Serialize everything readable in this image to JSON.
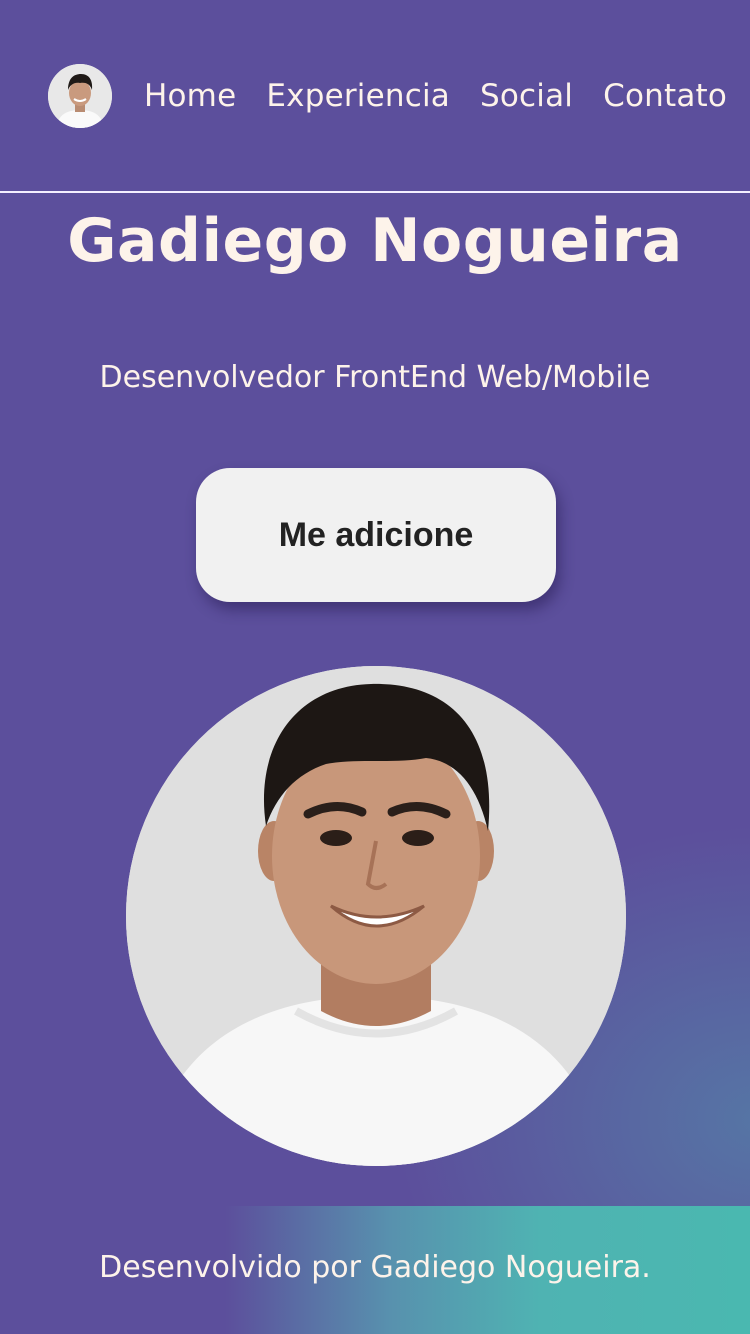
{
  "header": {
    "avatar_icon": "profile-avatar",
    "nav": [
      {
        "label": "Home"
      },
      {
        "label": "Experiencia"
      },
      {
        "label": "Social"
      },
      {
        "label": "Contato"
      }
    ]
  },
  "hero": {
    "title": "Gadiego Nogueira",
    "subtitle": "Desenvolvedor FrontEnd Web/Mobile",
    "cta_label": "Me adicione"
  },
  "footer": {
    "text": "Desenvolvido por Gadiego Nogueira."
  },
  "colors": {
    "background": "#5c4f9c",
    "text": "#fdf3ea",
    "button_bg": "#f1f1f1",
    "button_text": "#222222",
    "footer_accent": "#4ab8b0"
  }
}
